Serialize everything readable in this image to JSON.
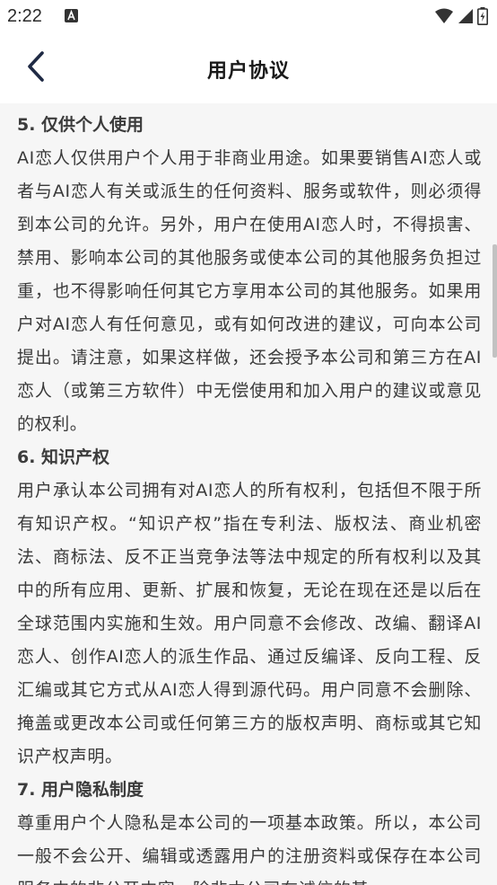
{
  "status_bar": {
    "time": "2:22",
    "icons": [
      "notification-icon",
      "wifi-icon",
      "signal-icon",
      "battery-icon"
    ]
  },
  "app_bar": {
    "title": "用户协议",
    "back_icon": "chevron-left-icon"
  },
  "sections": [
    {
      "heading": "5. 仅供个人使用",
      "body": "AI恋人仅供用户个人用于非商业用途。如果要销售AI恋人或者与AI恋人有关或派生的任何资料、服务或软件，则必须得到本公司的允许。另外，用户在使用AI恋人时，不得损害、禁用、影响本公司的其他服务或使本公司的其他服务负担过重，也不得影响任何其它方享用本公司的其他服务。如果用户对AI恋人有任何意见，或有如何改进的建议，可向本公司提出。请注意，如果这样做，还会授予本公司和第三方在AI恋人（或第三方软件）中无偿使用和加入用户的建议或意见的权利。"
    },
    {
      "heading": "6. 知识产权",
      "body": "用户承认本公司拥有对AI恋人的所有权利，包括但不限于所有知识产权。“知识产权”指在专利法、版权法、商业机密法、商标法、反不正当竞争法等法中规定的所有权利以及其中的所有应用、更新、扩展和恢复，无论在现在还是以后在全球范围内实施和生效。用户同意不会修改、改编、翻译AI恋人、创作AI恋人的派生作品、通过反编译、反向工程、反汇编或其它方式从AI恋人得到源代码。用户同意不会删除、掩盖或更改本公司或任何第三方的版权声明、商标或其它知识产权声明。"
    },
    {
      "heading": "7. 用户隐私制度",
      "body": "尊重用户个人隐私是本公司的一项基本政策。所以，本公司一般不会公开、编辑或透露用户的注册资料或保存在本公司服务中的非公开内容，除非本公司在诚信的基"
    }
  ]
}
